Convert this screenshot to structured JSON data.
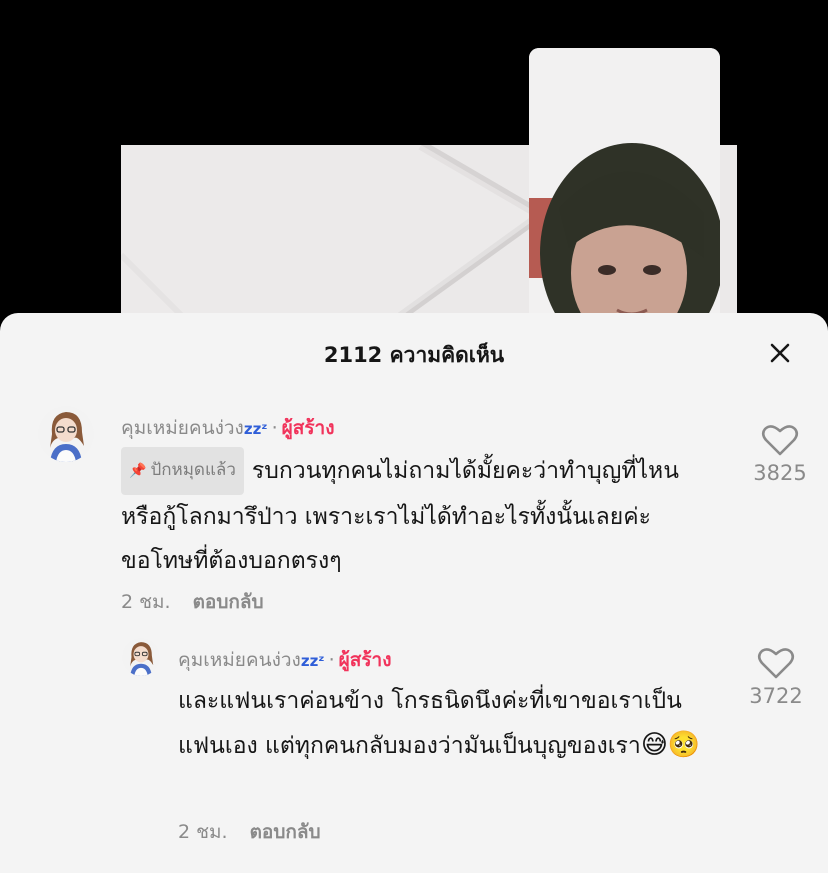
{
  "sheet": {
    "comment_count": "2112",
    "title_suffix": "ความคิดเห็น"
  },
  "comments": [
    {
      "username": "คุมเหม่ยคนง่วง",
      "zzz": "zzᶻ",
      "creator_label": "ผู้สร้าง",
      "pinned_label": "ปักหมุดแล้ว",
      "text": "รบกวนทุกคนไม่ถามได้มั้ยคะว่าทำบุญที่ไหน หรือกู้โลกมารึป่าว เพราะเราไม่ได้ทำอะไรทั้งนั้นเลยค่ะ ขอโทษที่ต้องบอกตรงๆ",
      "time": "2 ชม.",
      "reply_label": "ตอบกลับ",
      "likes": "3825"
    },
    {
      "username": "คุมเหม่ยคนง่วง",
      "zzz": "zzᶻ",
      "creator_label": "ผู้สร้าง",
      "text": "และแฟนเราค่อนข้าง โกรธนิดนึงค่ะที่เขาขอเราเป็นแฟนเอง แต่ทุกคนกลับมองว่ามันเป็นบุญของเรา",
      "emojis": "😅🥺",
      "time": "2 ชม.",
      "reply_label": "ตอบกลับ",
      "likes": "3722"
    }
  ],
  "icons": {
    "close": "close-icon",
    "like": "heart-icon",
    "pin": "pin-icon"
  },
  "colors": {
    "creator": "#f1335b",
    "zzz": "#2f5ed8",
    "muted": "#8a8a8a",
    "sheet_bg": "#f4f4f4"
  }
}
